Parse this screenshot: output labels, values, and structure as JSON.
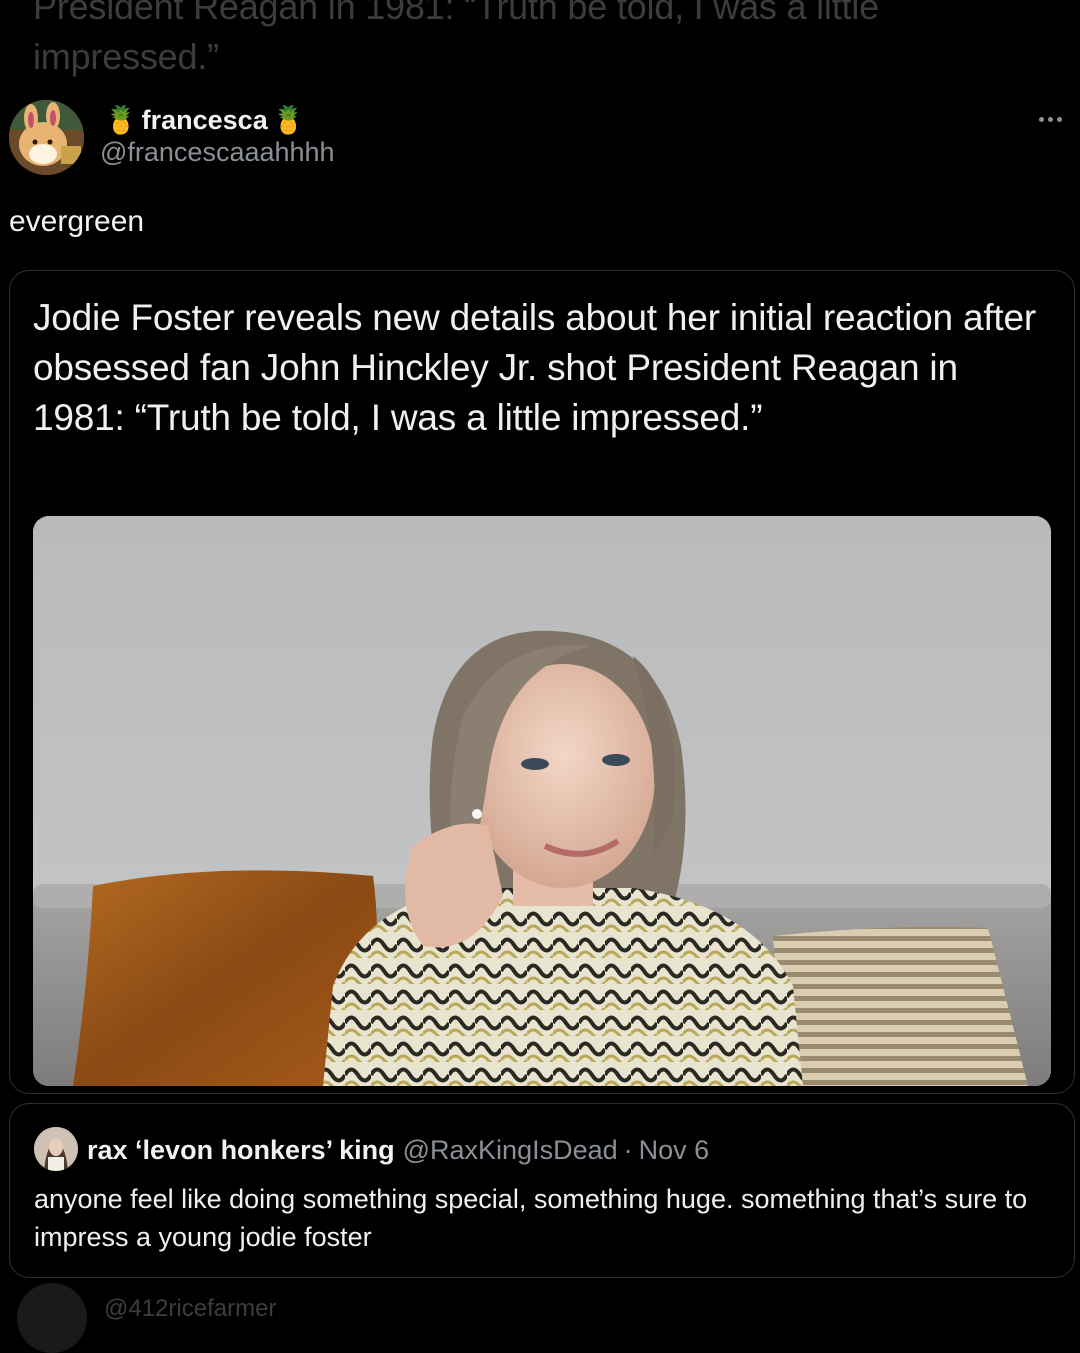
{
  "previous_tweet": {
    "text_fade": "President Reagan in 1981: “Truth be told, I was a little impressed.”"
  },
  "tweet": {
    "author_name": "francesca",
    "author_emoji": "🍍",
    "handle": "@francescaaahhhh",
    "text": "evergreen",
    "more_icon": "more-horizontal-icon"
  },
  "media_card": {
    "headline": "Jodie Foster reveals new details about her initial reaction after obsessed fan John Hinckley Jr. shot President Reagan in 1981: “Truth be told, I was a little impressed.”"
  },
  "quoted_tweet": {
    "author_name": "rax ‘levon honkers’ king",
    "handle": "@RaxKingIsDead",
    "separator": "·",
    "date": "Nov 6",
    "text": "anyone feel like doing something special, something huge. something that’s sure to impress a young jodie foster"
  },
  "next_tweet": {
    "handle_fade": "@412ricefarmer"
  },
  "colors": {
    "background": "#000000",
    "primary_text": "#e7e9ea",
    "secondary_text": "#8b9096",
    "border": "#2b2f33"
  }
}
